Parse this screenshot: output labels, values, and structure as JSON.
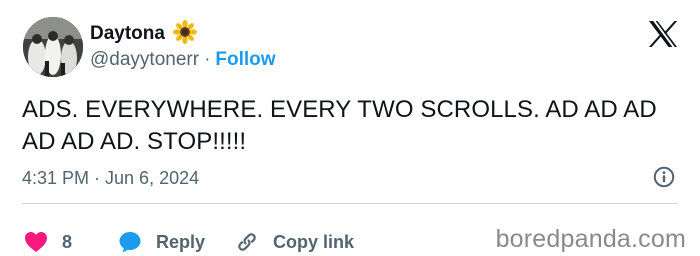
{
  "user": {
    "display_name": "Daytona",
    "emoji": "🌻",
    "handle": "@dayytonerr",
    "separator": "·",
    "follow_label": "Follow"
  },
  "tweet": {
    "text": "ADS. EVERYWHERE. EVERY TWO SCROLLS. AD AD AD AD AD AD. STOP!!!!!",
    "timestamp": "4:31 PM · Jun 6, 2024"
  },
  "actions": {
    "like_count": "8",
    "reply_label": "Reply",
    "copy_link_label": "Copy link"
  },
  "watermark": "boredpanda.com",
  "colors": {
    "like": "#f91880",
    "reply": "#1d9bf0",
    "follow": "#1d9bf0",
    "muted": "#536471"
  },
  "icons": {
    "brand": "x-logo-icon",
    "info": "info-icon",
    "like": "heart-icon",
    "reply": "speech-bubble-icon",
    "copy_link": "link-icon"
  }
}
